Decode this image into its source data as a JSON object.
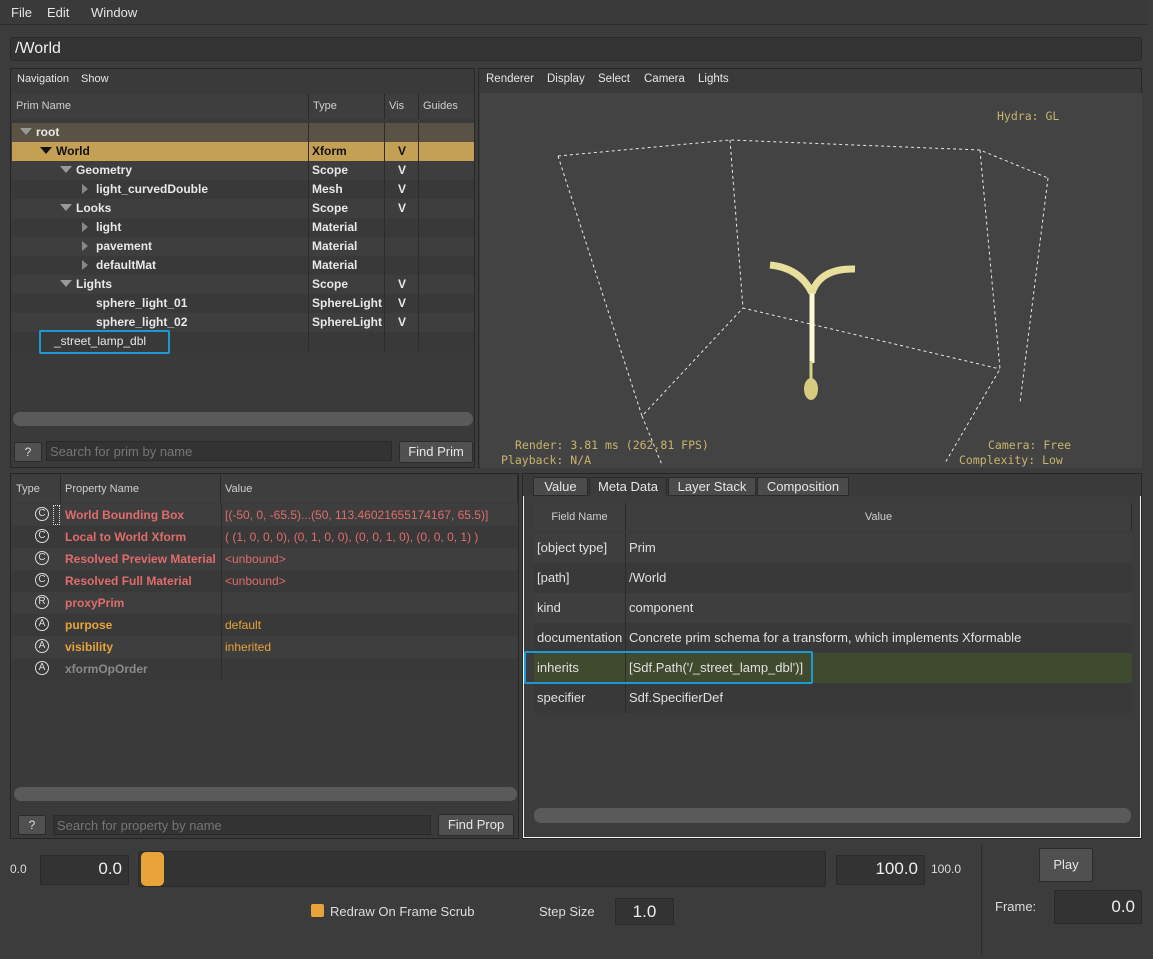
{
  "menu": [
    "File",
    "Edit",
    "Window"
  ],
  "path": "/World",
  "prim_panel": {
    "tabs": [
      "Navigation",
      "Show"
    ],
    "columns": [
      "Prim Name",
      "Type",
      "Vis",
      "Guides"
    ],
    "rows": [
      {
        "name": "root",
        "type": "",
        "vis": "",
        "expanded": true
      },
      {
        "name": "World",
        "type": "Xform",
        "vis": "V",
        "expanded": true,
        "selected": true
      },
      {
        "name": "Geometry",
        "type": "Scope",
        "vis": "V",
        "expanded": true
      },
      {
        "name": "light_curvedDouble",
        "type": "Mesh",
        "vis": "V",
        "expanded": false
      },
      {
        "name": "Looks",
        "type": "Scope",
        "vis": "V",
        "expanded": true
      },
      {
        "name": "light",
        "type": "Material",
        "vis": "",
        "expanded": false
      },
      {
        "name": "pavement",
        "type": "Material",
        "vis": "",
        "expanded": false
      },
      {
        "name": "defaultMat",
        "type": "Material",
        "vis": "",
        "expanded": false
      },
      {
        "name": "Lights",
        "type": "Scope",
        "vis": "V",
        "expanded": true
      },
      {
        "name": "sphere_light_01",
        "type": "SphereLight",
        "vis": "V"
      },
      {
        "name": "sphere_light_02",
        "type": "SphereLight",
        "vis": "V"
      },
      {
        "name": "_street_lamp_dbl",
        "type": "",
        "vis": ""
      }
    ],
    "help_label": "?",
    "search_placeholder": "Search for prim by name",
    "find_label": "Find Prim"
  },
  "viewport": {
    "menus": [
      "Renderer",
      "Display",
      "Select",
      "Camera",
      "Lights"
    ],
    "hydra": "Hydra: GL",
    "render_stat": "Render: 3.81 ms (262.81 FPS)",
    "playback": "Playback: N/A",
    "camera": "Camera: Free",
    "complexity": "Complexity: Low"
  },
  "prop_panel": {
    "columns": [
      "Type",
      "Property Name",
      "Value"
    ],
    "rows": [
      {
        "icon": "C",
        "name": "World Bounding Box",
        "value": "[(-50, 0, -65.5)...(50, 113.46021655174167, 65.5)]",
        "color": "#e06c6c"
      },
      {
        "icon": "C",
        "name": "Local to World Xform",
        "value": "( (1, 0, 0, 0), (0, 1, 0, 0), (0, 0, 1, 0), (0, 0, 0, 1) )",
        "color": "#e06c6c"
      },
      {
        "icon": "C",
        "name": "Resolved Preview Material",
        "value": "<unbound>",
        "color": "#e06c6c"
      },
      {
        "icon": "C",
        "name": "Resolved Full Material",
        "value": "<unbound>",
        "color": "#e06c6c"
      },
      {
        "icon": "R",
        "name": "proxyPrim",
        "value": "",
        "color": "#e06c6c"
      },
      {
        "icon": "A",
        "name": "purpose",
        "value": "default",
        "color": "#e8a33a"
      },
      {
        "icon": "A",
        "name": "visibility",
        "value": "inherited",
        "color": "#e8a33a"
      },
      {
        "icon": "A",
        "name": "xformOpOrder",
        "value": "",
        "color": "#8a8a8a"
      }
    ],
    "help_label": "?",
    "search_placeholder": "Search for property by name",
    "find_label": "Find Prop"
  },
  "meta_panel": {
    "tabs": [
      "Value",
      "Meta Data",
      "Layer Stack",
      "Composition"
    ],
    "columns": [
      "Field Name",
      "Value"
    ],
    "rows": [
      {
        "field": "[object type]",
        "value": "Prim"
      },
      {
        "field": "[path]",
        "value": "/World"
      },
      {
        "field": "kind",
        "value": "component"
      },
      {
        "field": "documentation",
        "value": "Concrete prim schema for a transform, which implements Xformable"
      },
      {
        "field": "inherits",
        "value": "[Sdf.Path('/_street_lamp_dbl')]",
        "highlighted": true
      },
      {
        "field": "specifier",
        "value": "Sdf.SpecifierDef"
      }
    ]
  },
  "timeline": {
    "start_label": "0.0",
    "start_value": "0.0",
    "end_value": "100.0",
    "end_label": "100.0",
    "redraw_label": "Redraw On Frame Scrub",
    "step_label": "Step Size",
    "step_value": "1.0",
    "play_label": "Play",
    "frame_label": "Frame:",
    "frame_value": "0.0"
  },
  "colors": {
    "selection": "#c4a055",
    "accent": "#e8a33a",
    "highlight_box": "#1d9ad6",
    "computed_prop": "#e06c6c"
  }
}
